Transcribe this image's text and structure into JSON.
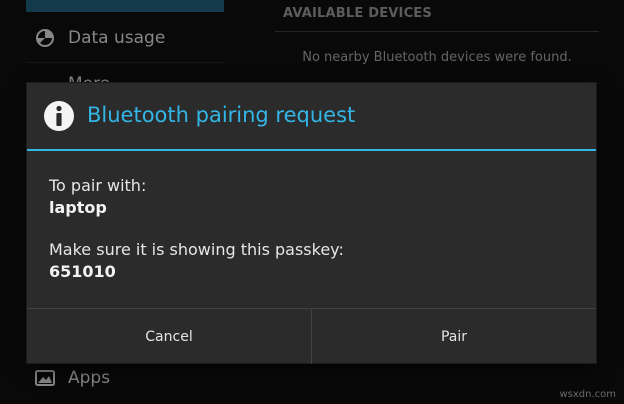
{
  "background": {
    "left_items": [
      {
        "label": "Data usage",
        "icon": "data-usage-icon"
      },
      {
        "label": "More...",
        "icon": "more-icon"
      },
      {
        "label": "Apps",
        "icon": "apps-icon"
      }
    ],
    "section_header": "AVAILABLE DEVICES",
    "no_devices_text": "No nearby Bluetooth devices were found."
  },
  "dialog": {
    "icon": "info-icon",
    "title": "Bluetooth pairing request",
    "pair_with_label": "To pair with:",
    "device_name": "laptop",
    "passkey_label": "Make sure it is showing this passkey:",
    "passkey": "651010",
    "cancel_label": "Cancel",
    "pair_label": "Pair"
  },
  "colors": {
    "accent": "#33b5e5",
    "dialog_bg": "#2b2b2b",
    "screen_bg": "#0e0e0e"
  },
  "watermark": "wsxdn.com"
}
